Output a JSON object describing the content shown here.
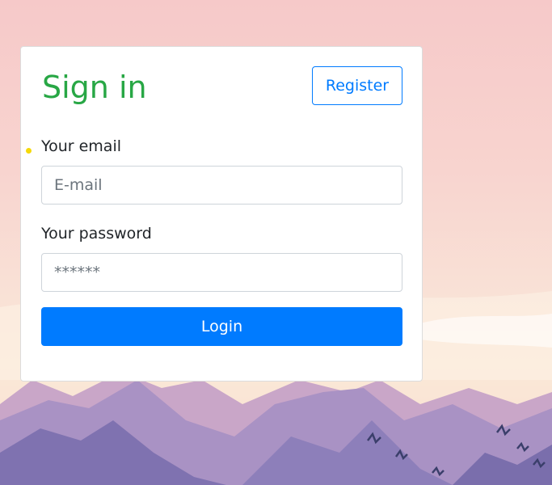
{
  "form": {
    "title": "Sign in",
    "register_label": "Register",
    "email_label": "Your email",
    "email_placeholder": "E-mail",
    "email_value": "",
    "password_label": "Your password",
    "password_placeholder": "******",
    "password_value": "",
    "login_label": "Login"
  },
  "colors": {
    "title": "#28a745",
    "primary": "#007bff",
    "card_background": "#ffffff"
  },
  "background": {
    "image": "mountain-landscape"
  }
}
